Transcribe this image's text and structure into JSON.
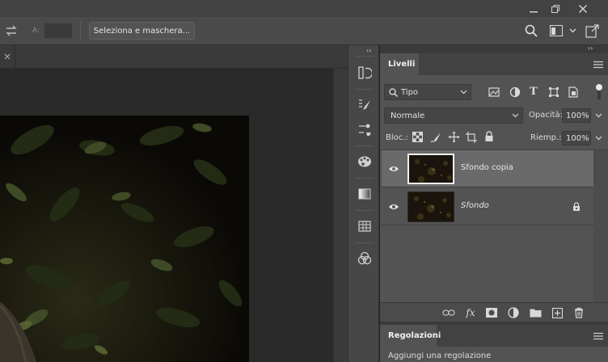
{
  "optionsbar": {
    "a_label": "A:",
    "select_mask_label": "Seleziona e maschera..."
  },
  "window": {
    "minimize": "—",
    "close": "✕"
  },
  "layers_panel": {
    "tab_label": "Livelli",
    "filter_kind": "Tipo",
    "blend_mode": "Normale",
    "opacity_label": "Opacità:",
    "opacity_value": "100%",
    "lock_label": "Bloc.:",
    "fill_label": "Riemp.:",
    "fill_value": "100%",
    "layers": [
      {
        "name": "Sfondo copia",
        "visible": true,
        "selected": true,
        "locked": false
      },
      {
        "name": "Sfondo",
        "visible": true,
        "selected": false,
        "locked": true
      }
    ]
  },
  "adjustments_panel": {
    "tab_label": "Regolazioni",
    "hint": "Aggiungi una regolazione"
  },
  "colors": {
    "panel_bg": "#535353",
    "selected_layer": "#6a6a6a",
    "app_bg": "#282828",
    "toolbar_bg": "#4a4a4a"
  }
}
